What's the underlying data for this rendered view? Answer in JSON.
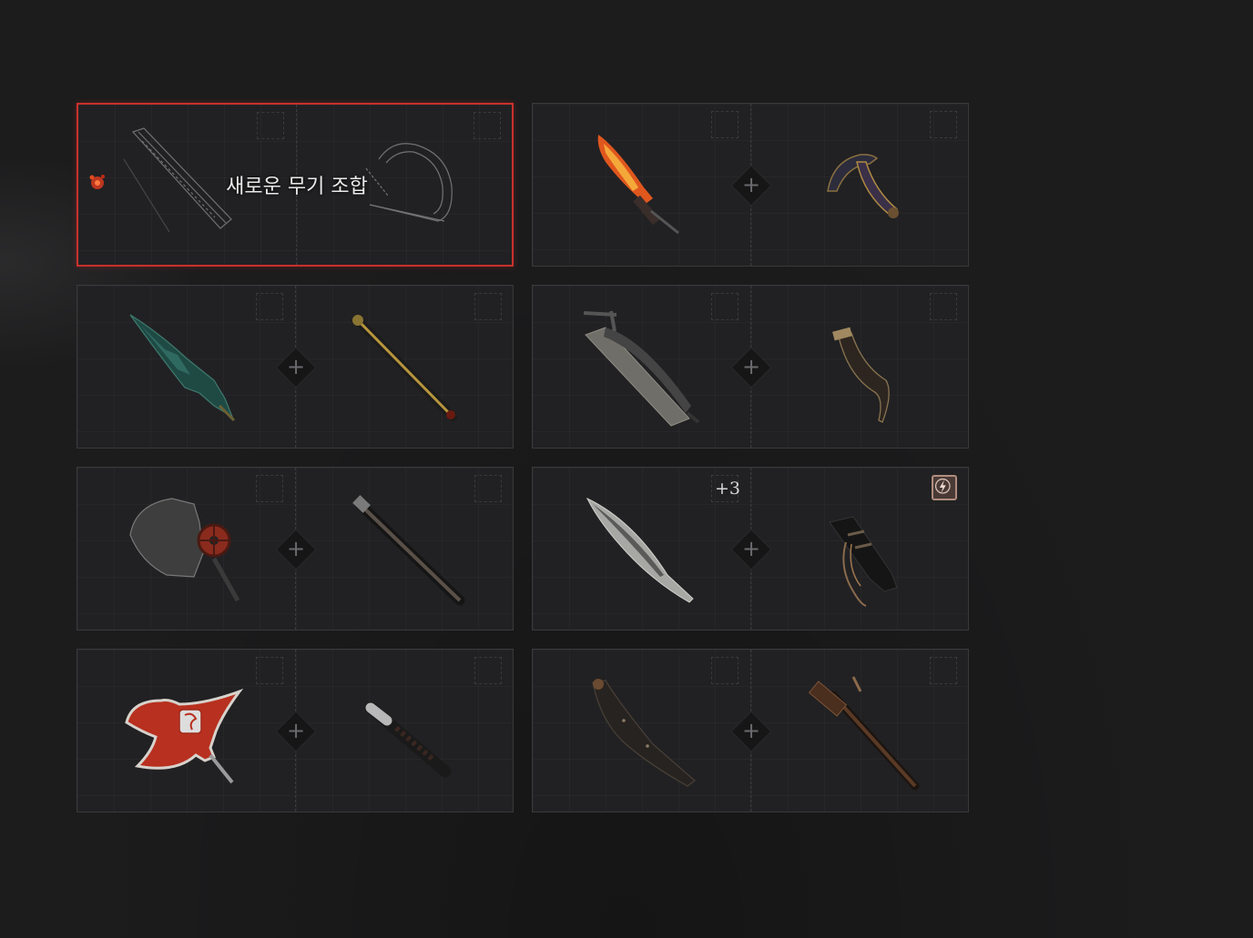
{
  "new_combo": {
    "label": "새로운 무기 조합"
  },
  "slots": [
    {
      "id": 1,
      "selected": true,
      "primary": "blueprint-blade",
      "secondary": "blueprint-crossbow-handle"
    },
    {
      "id": 2,
      "primary": "flaming-dagger",
      "secondary": "twisted-claw-handle"
    },
    {
      "id": 3,
      "primary": "green-crystal-blade",
      "secondary": "brass-pipe-handle"
    },
    {
      "id": 4,
      "primary": "saw-blade",
      "secondary": "curved-wooden-grip"
    },
    {
      "id": 5,
      "primary": "mechanical-gear-cleaver",
      "secondary": "wrapped-steel-rod"
    },
    {
      "id": 6,
      "primary": "curved-scimitar",
      "secondary": "tasseled-black-grip",
      "upgrade": "+3",
      "element": "lightning-icon"
    },
    {
      "id": 7,
      "primary": "red-fire-axe-head",
      "secondary": "taped-short-grip"
    },
    {
      "id": 8,
      "primary": "black-machete-blade",
      "secondary": "rusty-hammer-handle"
    }
  ],
  "colors": {
    "selection": "#c9302c",
    "background": "#1c1c1d",
    "slot": "#212123"
  }
}
